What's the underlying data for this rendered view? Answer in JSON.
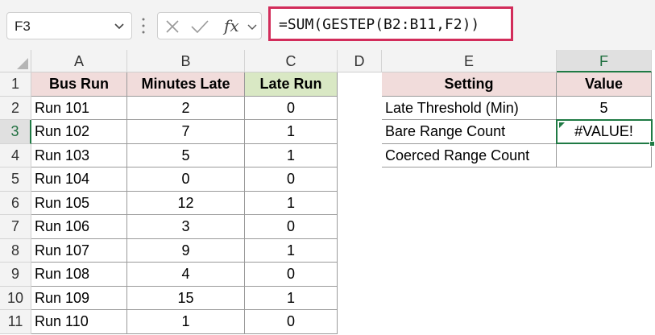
{
  "name_box": {
    "value": "F3"
  },
  "formula_bar": {
    "cancel_icon": "x-icon",
    "enter_icon": "check-icon",
    "fx_label": "fx",
    "formula": "=SUM(GESTEP(B2:B11,F2))"
  },
  "columns": [
    "A",
    "B",
    "C",
    "D",
    "E",
    "F"
  ],
  "rows": [
    "1",
    "2",
    "3",
    "4",
    "5",
    "6",
    "7",
    "8",
    "9",
    "10",
    "11"
  ],
  "active_cell": {
    "column": "F",
    "row": "3"
  },
  "table_main": {
    "headers": [
      "Bus Run",
      "Minutes Late",
      "Late Run"
    ],
    "rows": [
      [
        "Run 101",
        "2",
        "0"
      ],
      [
        "Run 102",
        "7",
        "1"
      ],
      [
        "Run 103",
        "5",
        "1"
      ],
      [
        "Run 104",
        "0",
        "0"
      ],
      [
        "Run 105",
        "12",
        "1"
      ],
      [
        "Run 106",
        "3",
        "0"
      ],
      [
        "Run 107",
        "9",
        "1"
      ],
      [
        "Run 108",
        "4",
        "0"
      ],
      [
        "Run 109",
        "15",
        "1"
      ],
      [
        "Run 110",
        "1",
        "0"
      ]
    ]
  },
  "table_settings": {
    "headers": [
      "Setting",
      "Value"
    ],
    "rows": [
      [
        "Late Threshold (Min)",
        "5"
      ],
      [
        "Bare Range Count",
        "#VALUE!"
      ],
      [
        "Coerced Range Count",
        ""
      ]
    ]
  },
  "colors": {
    "header_pink": "#f1dcdb",
    "header_green": "#d9e8c4",
    "selection": "#1f7a44",
    "formula_highlight": "#d22c5a"
  }
}
